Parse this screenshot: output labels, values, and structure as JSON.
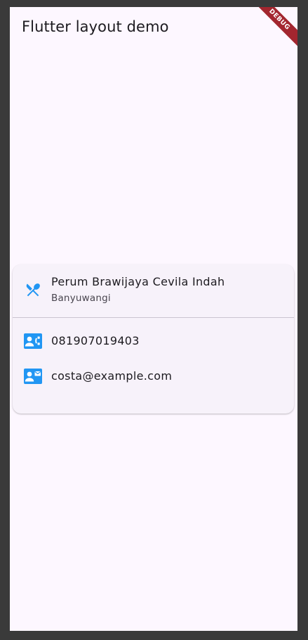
{
  "app_bar": {
    "title": "Flutter layout demo"
  },
  "debug_banner": {
    "label": "DEBUG"
  },
  "card": {
    "address": {
      "icon": "restaurant-icon",
      "title": "Perum Brawijaya Cevila Indah",
      "subtitle": "Banyuwangi"
    },
    "phone": {
      "icon": "contact-phone-icon",
      "title": "081907019403"
    },
    "email": {
      "icon": "contact-mail-icon",
      "title": "costa@example.com"
    }
  },
  "colors": {
    "accent": "#2196f3",
    "background": "#fdf7ff",
    "card": "#f7f2fa",
    "debug_banner": "#a3262f"
  }
}
